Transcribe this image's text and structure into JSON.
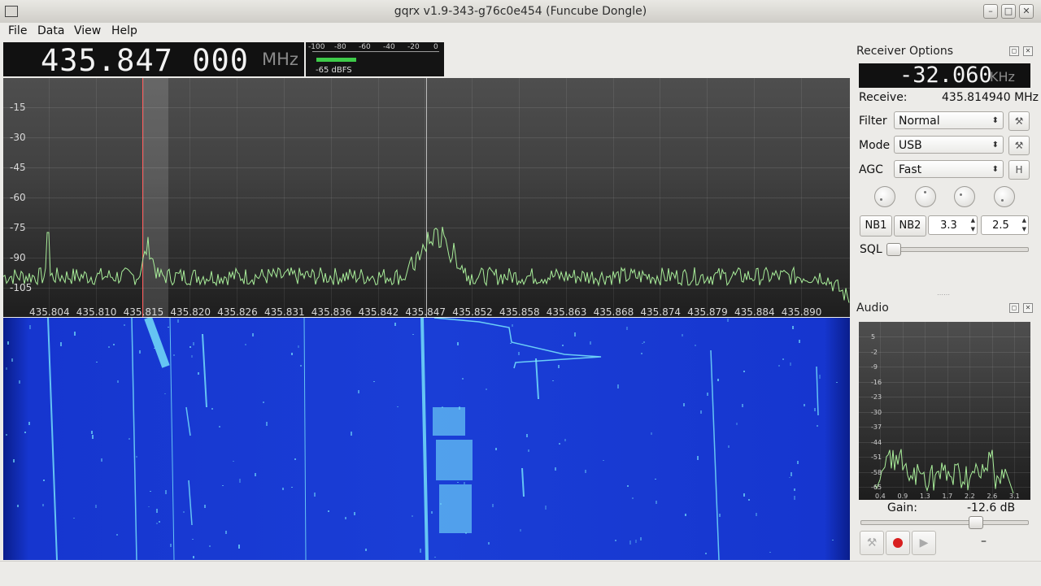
{
  "window": {
    "title": "gqrx v1.9-343-g76c0e454 (Funcube Dongle)"
  },
  "menu": [
    "File",
    "Data",
    "View",
    "Help"
  ],
  "frequency": {
    "value": "435.847 000",
    "unit": "MHz"
  },
  "smeter": {
    "ticks": [
      "-100",
      "-80",
      "-60",
      "-40",
      "-20",
      "0"
    ],
    "level": "-65 dBFS",
    "level_fraction": 0.35
  },
  "spectrum": {
    "y_labels": [
      "-15",
      "-30",
      "-45",
      "-60",
      "-75",
      "-90",
      "-105"
    ],
    "x_labels": [
      "435.804",
      "435.810",
      "435.815",
      "435.820",
      "435.826",
      "435.831",
      "435.836",
      "435.842",
      "435.847",
      "435.852",
      "435.858",
      "435.863",
      "435.868",
      "435.874",
      "435.879",
      "435.884",
      "435.890"
    ]
  },
  "receiver": {
    "title": "Receiver Options",
    "offset": "-32.060",
    "offset_unit": "KHz",
    "receive_label": "Receive:",
    "receive_value": "435.814940 MHz",
    "filter_label": "Filter",
    "filter_value": "Normal",
    "mode_label": "Mode",
    "mode_value": "USB",
    "agc_label": "AGC",
    "agc_value": "Fast",
    "agc_h": "H",
    "nb1": "NB1",
    "nb2": "NB2",
    "nb1_value": "3.3",
    "nb2_value": "2.5",
    "sql_label": "SQL",
    "sql_level": 0.0
  },
  "audio": {
    "title": "Audio",
    "y_labels": [
      "5",
      "-2",
      "-9",
      "-16",
      "-23",
      "-30",
      "-37",
      "-44",
      "-51",
      "-58",
      "-65"
    ],
    "x_labels": [
      "0.4",
      "0.9",
      "1.3",
      "1.7",
      "2.2",
      "2.6",
      "3.1"
    ],
    "gain_label": "Gain:",
    "gain_value": "-12.6 dB",
    "gain_level": 0.6,
    "dash": "–"
  },
  "colors": {
    "trace": "#a9ee9a",
    "waterfall_base": "#1a3ed6",
    "waterfall_signal": "#7ff3ff"
  }
}
